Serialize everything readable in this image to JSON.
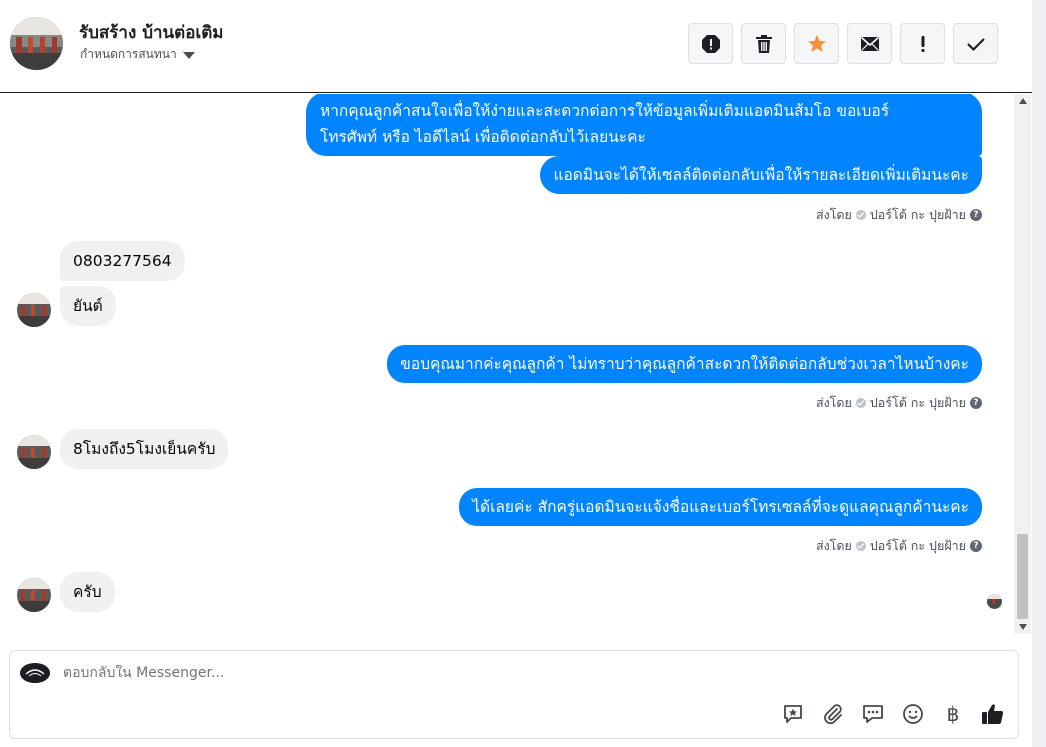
{
  "header": {
    "title": "รับสร้าง บ้านต่อเติม",
    "subtitle": "กำหนดการสนทนา",
    "toolbar": [
      {
        "name": "spam-icon",
        "tooltip": ""
      },
      {
        "name": "trash-icon",
        "tooltip": ""
      },
      {
        "name": "star-icon",
        "tooltip": ""
      },
      {
        "name": "envelope-icon",
        "tooltip": ""
      },
      {
        "name": "exclamation-icon",
        "tooltip": ""
      },
      {
        "name": "check-icon",
        "tooltip": ""
      }
    ],
    "star_color": "#f7923b"
  },
  "thread": {
    "messages": [
      {
        "direction": "out",
        "lines": [
          "หากคุณลูกค้าสนใจเพื่อให้ง่ายและสะดวกต่อการให้ข้อมูลเพิ่มเติมแอดมินส้มโอ ขอเบอร์",
          "โทรศัพท์ หรือ ไอดีไลน์ เพื่อติดต่อกลับไว้เลยนะคะ"
        ]
      },
      {
        "direction": "out",
        "text": "แอดมินจะได้ให้เซลล์ติดต่อกลับเพื่อให้รายละเอียดเพิ่มเติมนะคะ"
      },
      {
        "direction": "in",
        "text": "0803277564"
      },
      {
        "direction": "in",
        "text": "ยันต์"
      },
      {
        "direction": "out",
        "text": "ขอบคุณมากค่ะคุณลูกค้า ไม่ทราบว่าคุณลูกค้าสะดวกให้ติดต่อกลับช่วงเวลาไหนบ้างคะ"
      },
      {
        "direction": "in",
        "text": "8โมงถึง5โมงเย็นครับ"
      },
      {
        "direction": "out",
        "text": "ได้เลยค่ะ สักครู่แอดมินจะแจ้งชื่อและเบอร์โทรเซลล์ที่จะดูแลคุณลูกค้านะคะ"
      },
      {
        "direction": "in",
        "text": "ครับ"
      }
    ],
    "sent_by_label": "ส่งโดย",
    "sent_by_name": "ปอร์โต้ กะ ปุยฝ้าย",
    "help_glyph": "?",
    "bubble_out_color": "#0084ff",
    "bubble_in_color": "#f1f0f0"
  },
  "composer": {
    "placeholder": "ตอบกลับใน Messenger...",
    "icons": [
      "sticker-icon",
      "attachment-icon",
      "saved-reply-icon",
      "emoji-icon",
      "baht-icon",
      "like-icon"
    ],
    "baht_glyph": "฿"
  }
}
